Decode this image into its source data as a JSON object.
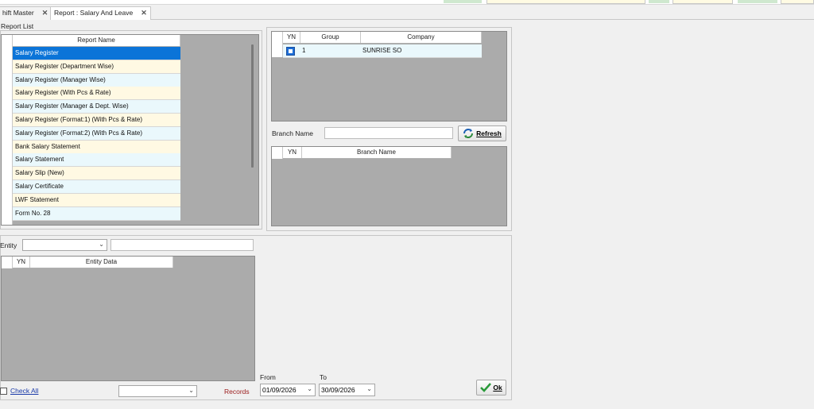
{
  "tabs": [
    {
      "label": "hift Master",
      "close": "✕"
    },
    {
      "label": "Report : Salary And Leave",
      "close": "✕"
    }
  ],
  "report_list": {
    "title": "Report List",
    "header": "Report Name",
    "items": [
      "Salary Register",
      "Salary Register (Department Wise)",
      "Salary Register (Manager Wise)",
      "Salary Register (With Pcs & Rate)",
      "Salary Register (Manager & Dept. Wise)",
      "Salary Register (Format:1) (With Pcs & Rate)",
      "Salary Register (Format:2) (With Pcs & Rate)",
      "Bank Salary Statement",
      "Salary Statement",
      "Salary Slip (New)",
      "Salary Certificate",
      "LWF Statement",
      "Form No. 28"
    ],
    "selected_index": 0
  },
  "company_grid": {
    "headers": {
      "yn": "YN",
      "group": "Group",
      "company": "Company"
    },
    "rows": [
      {
        "group": "1",
        "company": "SUNRISE SO"
      }
    ]
  },
  "branch": {
    "label": "Branch Name",
    "value": "",
    "refresh_label": "Refresh",
    "headers": {
      "yn": "YN",
      "branch_name": "Branch Name"
    }
  },
  "entity": {
    "label": "Entity",
    "value": "",
    "text": "",
    "headers": {
      "yn": "YN",
      "entity_data": "Entity Data"
    }
  },
  "check_all_label": "Check All",
  "records_label": "Records",
  "records_value": "",
  "date_range": {
    "from_label": "From",
    "from_value": "01/09/2026",
    "to_label": "To",
    "to_value": "30/09/2026"
  },
  "ok_label": "Ok",
  "colors": {
    "selected_row": "#0b74d8",
    "odd_row": "#eaf8fc",
    "even_row": "#fff9e3",
    "grid_empty": "#ababab",
    "records_label": "#9b1b1b",
    "link_blue": "#1a3aa8"
  }
}
